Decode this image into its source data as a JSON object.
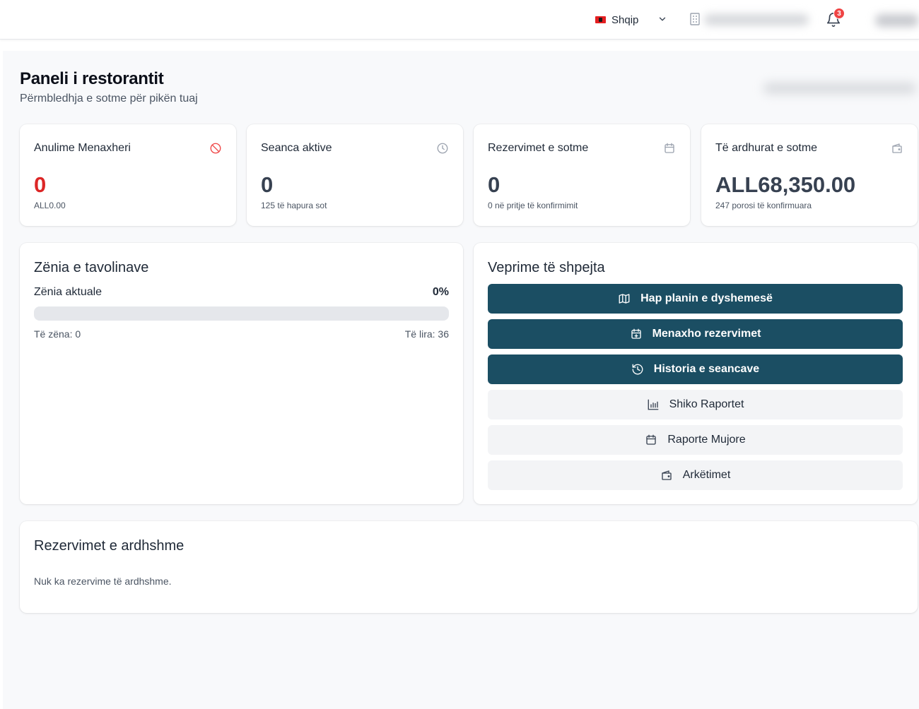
{
  "header": {
    "language": "Shqip",
    "notifications_count": "3",
    "colors": {
      "flag": "#e41e20",
      "badge": "#ef4444"
    }
  },
  "page": {
    "title": "Paneli i restorantit",
    "subtitle": "Përmbledhja e sotme për pikën tuaj"
  },
  "stats": [
    {
      "title": "Anulime Menaxheri",
      "value": "0",
      "sub": "ALL0.00",
      "icon": "ban-icon",
      "value_color": "#dc2626"
    },
    {
      "title": "Seanca aktive",
      "value": "0",
      "sub": "125 të hapura sot",
      "icon": "clock-icon"
    },
    {
      "title": "Rezervimet e sotme",
      "value": "0",
      "sub": "0 në pritje të konfirmimit",
      "icon": "calendar-icon"
    },
    {
      "title": "Të ardhurat e sotme",
      "value": "ALL68,350.00",
      "sub": "247 porosi të konfirmuara",
      "icon": "wallet-icon"
    }
  ],
  "occupancy": {
    "title": "Zënia e tavolinave",
    "current_label": "Zënia aktuale",
    "percent_text": "0%",
    "percent_value": 0,
    "occupied_text": "Të zëna: 0",
    "free_text": "Të lira: 36"
  },
  "quick_actions": {
    "title": "Veprime të shpejta",
    "buttons": [
      {
        "label": "Hap planin e dyshemesë",
        "icon": "map-icon",
        "style": "dark"
      },
      {
        "label": "Menaxho rezervimet",
        "icon": "calendar-plus-icon",
        "style": "dark"
      },
      {
        "label": "Historia e seancave",
        "icon": "history-icon",
        "style": "dark"
      },
      {
        "label": "Shiko Raportet",
        "icon": "bar-chart-icon",
        "style": "light"
      },
      {
        "label": "Raporte Mujore",
        "icon": "calendar-icon",
        "style": "light"
      },
      {
        "label": "Arkëtimet",
        "icon": "wallet-icon",
        "style": "light"
      }
    ],
    "colors": {
      "primary": "#1b4e63",
      "secondary_bg": "#f3f4f6"
    }
  },
  "upcoming": {
    "title": "Rezervimet e ardhshme",
    "empty_text": "Nuk ka rezervime të ardhshme."
  }
}
